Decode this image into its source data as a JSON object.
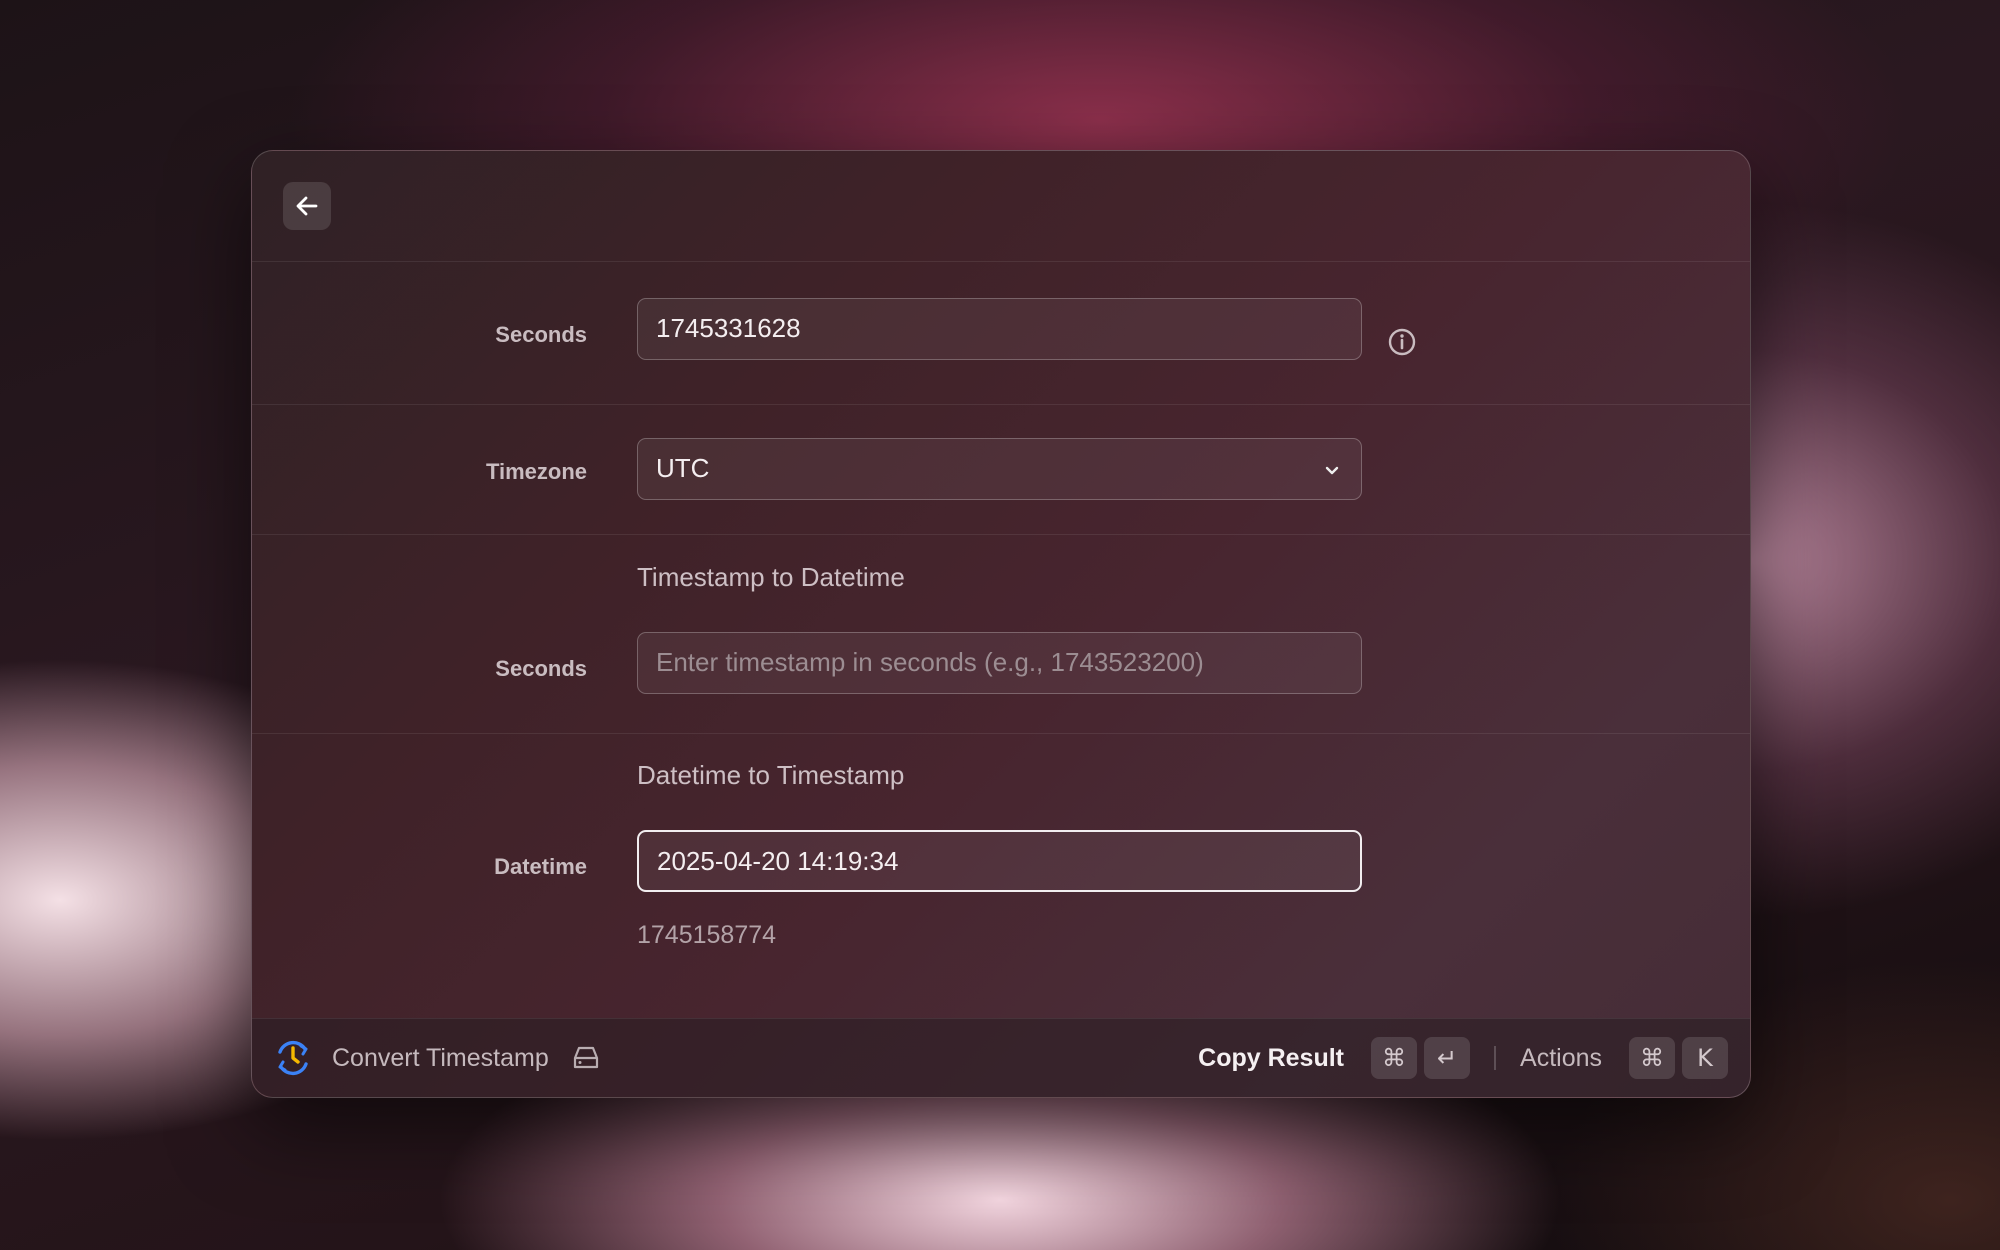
{
  "header": {
    "back_icon": "arrow-left-icon"
  },
  "form": {
    "seconds_label": "Seconds",
    "seconds_value": "1745331628",
    "info_icon": "info-icon",
    "timezone_label": "Timezone",
    "timezone_value": "UTC",
    "ts_to_dt": {
      "title": "Timestamp to Datetime",
      "label": "Seconds",
      "placeholder": "Enter timestamp in seconds (e.g., 1743523200)"
    },
    "dt_to_ts": {
      "title": "Datetime to Timestamp",
      "label": "Datetime",
      "value": "2025-04-20 14:19:34",
      "result": "1745158774"
    }
  },
  "footer": {
    "app_icon": "clock-refresh-icon",
    "app_name": "Convert Timestamp",
    "storage_icon": "drive-icon",
    "copy_label": "Copy Result",
    "copy_keys": [
      "⌘",
      "↵"
    ],
    "actions_label": "Actions",
    "actions_keys": [
      "⌘",
      "K"
    ]
  },
  "colors": {
    "accent_blue": "#3b82f6",
    "accent_yellow": "#f5b800"
  }
}
